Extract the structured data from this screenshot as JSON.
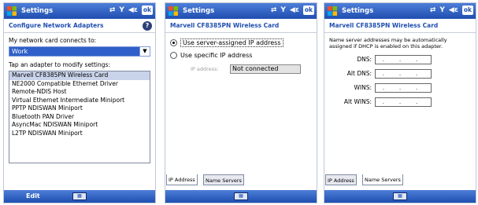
{
  "common": {
    "app_title": "Settings",
    "tray_ok": "ok",
    "status_icons": [
      "sync-icon",
      "signal-icon",
      "volume-icon"
    ]
  },
  "screen1": {
    "header": "Configure Network Adapters",
    "connects_label": "My network card connects to:",
    "connects_value": "Work",
    "adapter_label": "Tap an adapter to modify settings:",
    "adapters": [
      "Marvell CF8385PN Wireless Card",
      "NE2000 Compatible Ethernet Driver",
      "Remote-NDIS Host",
      "Virtual Ethernet Intermediate Miniport",
      "PPTP NDISWAN Miniport",
      "Bluetooth PAN Driver",
      "AsyncMac NDISWAN Miniport",
      "L2TP NDISWAN Miniport"
    ],
    "softkey_left": "Edit"
  },
  "screen2": {
    "header": "Marvell CF8385PN Wireless Card",
    "radio_server": "Use server-assigned IP address",
    "radio_specific": "Use specific IP address",
    "ip_label": "IP address:",
    "ip_value": "Not connected",
    "tabs": [
      "IP Address",
      "Name Servers"
    ]
  },
  "screen3": {
    "header": "Marvell CF8385PN Wireless Card",
    "description": "Name server addresses may be automatically assigned if DHCP is enabled on this adapter.",
    "fields": [
      {
        "label": "DNS:",
        "value": ". . ."
      },
      {
        "label": "Alt DNS:",
        "value": ". . ."
      },
      {
        "label": "WINS:",
        "value": ". . ."
      },
      {
        "label": "Alt WINS:",
        "value": ". . ."
      }
    ],
    "tabs": [
      "IP Address",
      "Name Servers"
    ]
  }
}
